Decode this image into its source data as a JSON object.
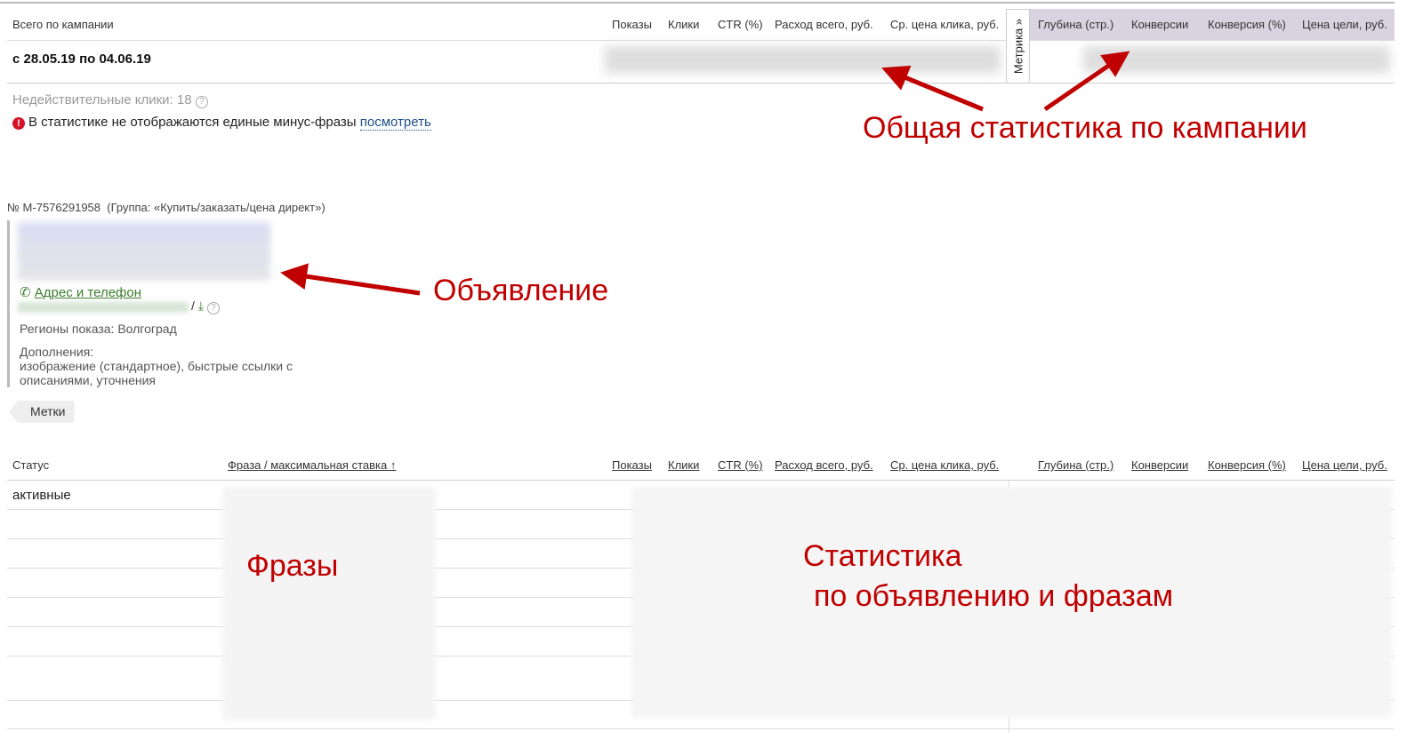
{
  "summary": {
    "title": "Всего по кампании",
    "period": "с 28.05.19 по 04.06.19",
    "columns": [
      "Показы",
      "Клики",
      "CTR (%)",
      "Расход всего, руб.",
      "Ср. цена клика, руб."
    ],
    "metrika_columns": [
      "Глубина (стр.)",
      "Конверсии",
      "Конверсия (%)",
      "Цена цели, руб."
    ],
    "metrika_tab": "Метрика »",
    "invalid_clicks": "Недействительные клики: 18",
    "warning_text": "В статистике не отображаются единые минус-фразы",
    "warning_link": "посмотреть"
  },
  "ad": {
    "id": "№ M-7576291958",
    "group": "(Группа: «Купить/заказать/цена директ»)",
    "contact_link": "Адрес и телефон",
    "slash": "/",
    "regions": "Регионы показа: Волгоград",
    "extras_label": "Дополнения:",
    "extras_line1": "изображение (стандартное), быстрые ссылки с",
    "extras_line2": "описаниями, уточнения",
    "tags_button": "Метки"
  },
  "phrases_table": {
    "status_header": "Статус",
    "phrase_header": "Фраза / максимальная ставка ↑",
    "columns": [
      "Показы",
      "Клики",
      "CTR (%)",
      "Расход всего, руб.",
      "Ср. цена клика, руб."
    ],
    "metrika_columns": [
      "Глубина (стр.)",
      "Конверсии",
      "Конверсия (%)",
      "Цена цели, руб."
    ],
    "status_value": "активные"
  },
  "annotations": {
    "campaign": "Общая статистика по кампании",
    "ad": "Объявление",
    "phrases": "Фразы",
    "stats_line1": "Статистика",
    "stats_line2": "по объявлению и фразам"
  },
  "colors": {
    "accent": "#c00000",
    "link": "#1a4f8b",
    "green": "#3a7d2c",
    "metrika_bg": "#d8d3df"
  }
}
